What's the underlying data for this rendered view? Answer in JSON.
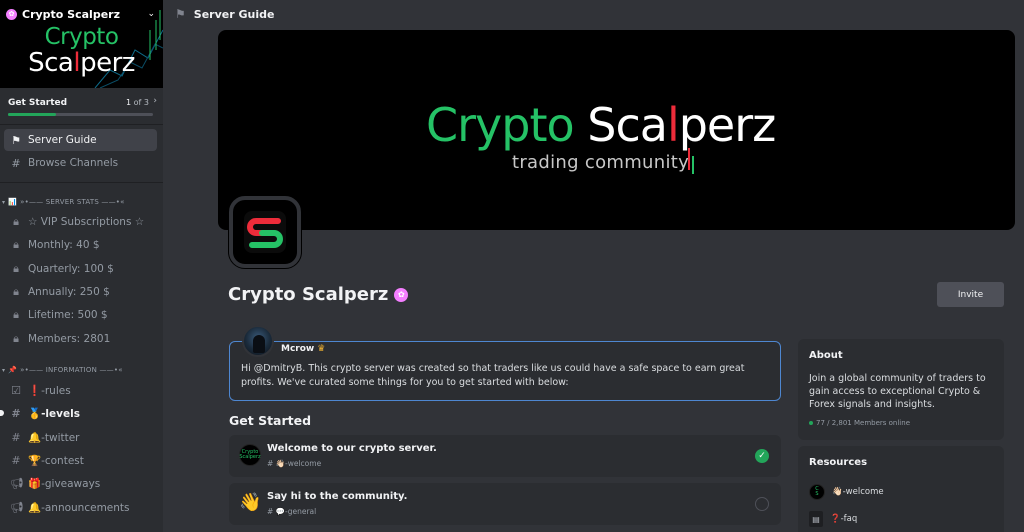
{
  "sidebar": {
    "server_name": "Crypto Scalperz",
    "banner_logo": {
      "line1": "Crypto",
      "line2_a": "Sca",
      "line2_b": "l",
      "line2_c": "perz"
    },
    "get_started": {
      "label": "Get Started",
      "current": "1",
      "of": "of 3",
      "progress": 0.33
    },
    "nav": [
      {
        "label": "Server Guide",
        "icon": "signpost-icon",
        "active": true
      },
      {
        "label": "Browse Channels",
        "icon": "channels-icon",
        "active": false
      }
    ],
    "categories": [
      {
        "label": "»•—— SERVER STATS ——•«",
        "emoji": "📊",
        "channels": [
          {
            "label": "☆ VIP Subscriptions ☆",
            "icon": "lock-icon"
          },
          {
            "label": "Monthly: 40 $",
            "icon": "lock-icon"
          },
          {
            "label": "Quarterly: 100 $",
            "icon": "lock-icon"
          },
          {
            "label": "Annually: 250 $",
            "icon": "lock-icon"
          },
          {
            "label": "Lifetime: 500 $",
            "icon": "lock-icon"
          },
          {
            "label": "Members: 2801",
            "icon": "lock-icon"
          }
        ]
      },
      {
        "label": "»•—— INFORMATION ——•«",
        "emoji": "📌",
        "channels": [
          {
            "label": "❗-rules",
            "icon": "rules-icon",
            "unread": false
          },
          {
            "label": "🥇-levels",
            "icon": "hash-icon",
            "unread": true
          },
          {
            "label": "🔔-twitter",
            "icon": "hash-icon",
            "unread": false
          },
          {
            "label": "🏆-contest",
            "icon": "hash-icon",
            "unread": false
          },
          {
            "label": "🎁-giveaways",
            "icon": "announcement-icon",
            "unread": false
          },
          {
            "label": "🔔-announcements",
            "icon": "announcement-icon",
            "unread": false
          }
        ]
      }
    ]
  },
  "topbar": {
    "title": "Server Guide",
    "icon": "signpost-icon"
  },
  "banner": {
    "title_green": "Crypto",
    "title_white_a": "Sca",
    "title_red": "l",
    "title_white_b": "perz",
    "subtitle": "trading community"
  },
  "server": {
    "name": "Crypto Scalperz",
    "invite_label": "Invite"
  },
  "welcome": {
    "author": "Mcrow",
    "author_badge": "crown-icon",
    "message": "Hi @DmitryB. This crypto server was created so that traders like us could have a safe space to earn great profits. We've curated some things for you to get started with below:"
  },
  "get_started_section": {
    "title": "Get Started",
    "tasks": [
      {
        "title": "Welcome to our crypto server.",
        "channel": "# 👋🏻-welcome",
        "done": true
      },
      {
        "title": "Say hi to the community.",
        "channel": "# 💬-general",
        "done": false
      }
    ]
  },
  "about": {
    "title": "About",
    "description": "Join a global community of traders to gain access to exceptional Crypto & Forex signals and insights.",
    "members": "77 / 2,801 Members online"
  },
  "resources": {
    "title": "Resources",
    "items": [
      {
        "label": "👋🏻-welcome",
        "icon": "server-logo-icon"
      },
      {
        "label": "❓-faq",
        "icon": "document-icon"
      }
    ]
  },
  "colors": {
    "accent_green": "#23a55a",
    "brand_green": "#25c266",
    "brand_red": "#ed2c3a",
    "boost_pink": "#f47fff",
    "focus_blue": "#4e87d1"
  }
}
